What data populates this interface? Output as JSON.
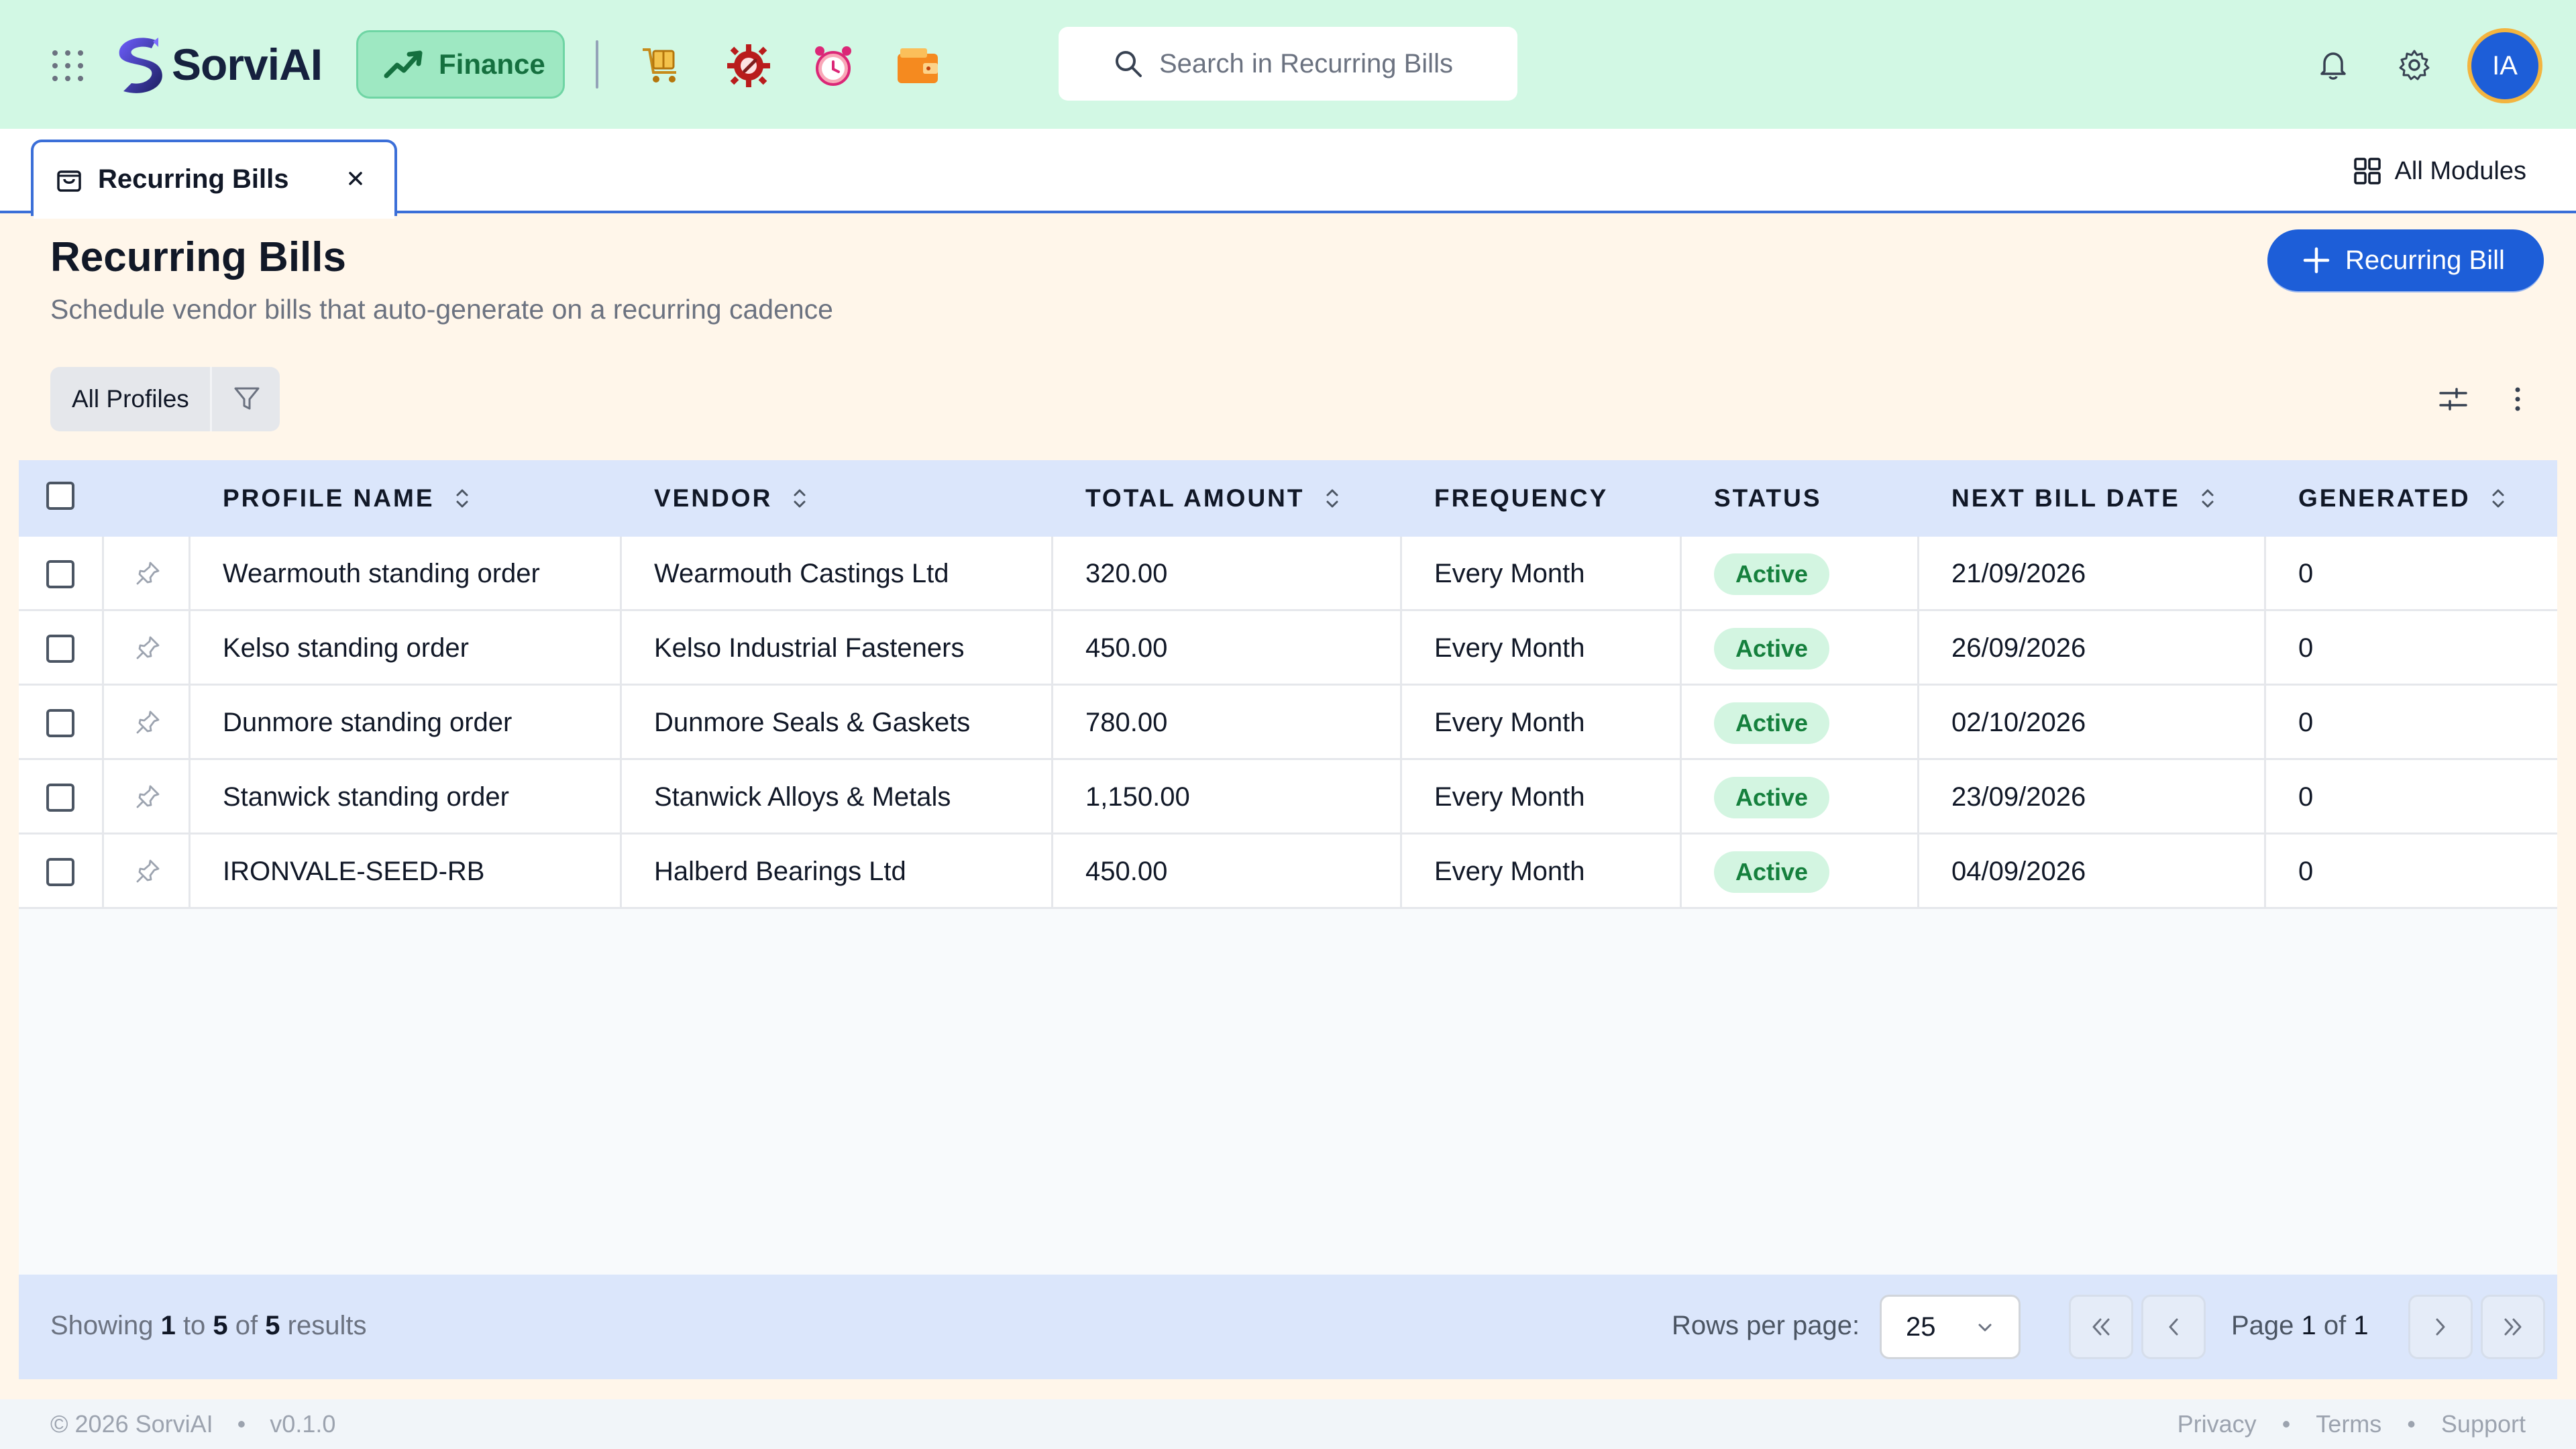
{
  "app": {
    "name": "SorviAI"
  },
  "topbar": {
    "active_module": "Finance",
    "search_placeholder": "Search in Recurring Bills",
    "avatar_initials": "IA"
  },
  "tabs": [
    {
      "label": "Recurring Bills"
    }
  ],
  "all_modules_label": "All Modules",
  "page": {
    "title": "Recurring Bills",
    "subtitle": "Schedule vendor bills that auto-generate on a recurring cadence",
    "primary_action": "Recurring Bill"
  },
  "filter": {
    "label": "All Profiles"
  },
  "table": {
    "columns": [
      "PROFILE NAME",
      "VENDOR",
      "TOTAL AMOUNT",
      "FREQUENCY",
      "STATUS",
      "NEXT BILL DATE",
      "GENERATED"
    ],
    "rows": [
      {
        "profile": "Wearmouth standing order",
        "vendor": "Wearmouth Castings Ltd",
        "amount": "320.00",
        "frequency": "Every Month",
        "status": "Active",
        "next_date": "21/09/2026",
        "generated": "0"
      },
      {
        "profile": "Kelso standing order",
        "vendor": "Kelso Industrial Fasteners",
        "amount": "450.00",
        "frequency": "Every Month",
        "status": "Active",
        "next_date": "26/09/2026",
        "generated": "0"
      },
      {
        "profile": "Dunmore standing order",
        "vendor": "Dunmore Seals & Gaskets",
        "amount": "780.00",
        "frequency": "Every Month",
        "status": "Active",
        "next_date": "02/10/2026",
        "generated": "0"
      },
      {
        "profile": "Stanwick standing order",
        "vendor": "Stanwick Alloys & Metals",
        "amount": "1,150.00",
        "frequency": "Every Month",
        "status": "Active",
        "next_date": "23/09/2026",
        "generated": "0"
      },
      {
        "profile": "IRONVALE-SEED-RB",
        "vendor": "Halberd Bearings Ltd",
        "amount": "450.00",
        "frequency": "Every Month",
        "status": "Active",
        "next_date": "04/09/2026",
        "generated": "0"
      }
    ]
  },
  "pagination": {
    "showing_prefix": "Showing",
    "from": "1",
    "to_word": "to",
    "to": "5",
    "of_word": "of",
    "total": "5",
    "results_word": "results",
    "rows_per_page_label": "Rows per page:",
    "rows_per_page": "25",
    "page_word": "Page",
    "current_page": "1",
    "page_of_word": "of",
    "total_pages": "1"
  },
  "footer": {
    "copyright": "© 2026 SorviAI",
    "version": "v0.1.0",
    "links": [
      "Privacy",
      "Terms",
      "Support"
    ]
  },
  "colors": {
    "topbar_bg": "#d2f8e4",
    "accent_blue": "#1d5ed8",
    "status_active_bg": "#d3f5e1",
    "status_active_fg": "#15803d"
  }
}
